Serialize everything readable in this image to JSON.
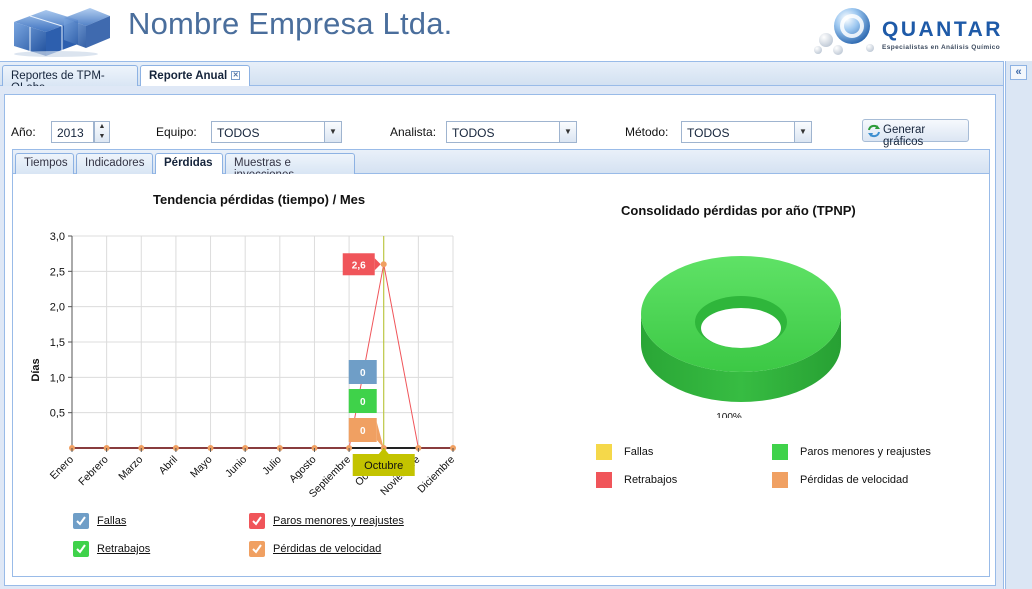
{
  "header": {
    "company_name": "Nombre Empresa Ltda.",
    "brand_name": "QUANTAR",
    "brand_tagline": "Especialistas en Análisis Químico"
  },
  "main_tabs": [
    {
      "label": "Reportes de TPM-QLabs",
      "active": false
    },
    {
      "label": "Reporte Anual",
      "active": true,
      "closable": true
    }
  ],
  "collapse_icon": "double-chevron-left-icon",
  "filters": {
    "year_label": "Año:",
    "year_value": "2013",
    "equipo_label": "Equipo:",
    "equipo_value": "TODOS",
    "analista_label": "Analista:",
    "analista_value": "TODOS",
    "metodo_label": "Método:",
    "metodo_value": "TODOS",
    "generate_label": "Generar gráficos",
    "generate_icon": "refresh-icon"
  },
  "sub_tabs": [
    {
      "label": "Tiempos",
      "active": false
    },
    {
      "label": "Indicadores",
      "active": false
    },
    {
      "label": "Pérdidas",
      "active": true
    },
    {
      "label": "Muestras e inyecciones",
      "active": false
    }
  ],
  "chart_data": [
    {
      "type": "line",
      "title": "Tendencia pérdidas (tiempo) / Mes",
      "xlabel": "",
      "ylabel": "Días",
      "ylim": [
        0,
        3.0
      ],
      "y_ticks": [
        "3,0",
        "2,5",
        "2,0",
        "1,5",
        "1,0",
        "0,5"
      ],
      "categories": [
        "Enero",
        "Febrero",
        "Marzo",
        "Abril",
        "Mayo",
        "Junio",
        "Julio",
        "Agosto",
        "Septiembre",
        "Octubre",
        "Noviembre",
        "Diciembre"
      ],
      "grid": true,
      "legend_position": "bottom",
      "series": [
        {
          "name": "Fallas",
          "color": "#6f9ec7",
          "values": [
            0,
            0,
            0,
            0,
            0,
            0,
            0,
            0,
            0,
            0,
            0,
            0
          ]
        },
        {
          "name": "Paros menores y reajustes",
          "color": "#f0555a",
          "values": [
            0,
            0,
            0,
            0,
            0,
            0,
            0,
            0,
            0,
            2.6,
            0,
            0
          ]
        },
        {
          "name": "Retrabajos",
          "color": "#3fd24a",
          "values": [
            0,
            0,
            0,
            0,
            0,
            0,
            0,
            0,
            0,
            0,
            0,
            0
          ]
        },
        {
          "name": "Pérdidas de velocidad",
          "color": "#f0a062",
          "values": [
            0,
            0,
            0,
            0,
            0,
            0,
            0,
            0,
            0,
            0,
            0,
            0
          ]
        }
      ],
      "tooltip": {
        "category": "Octubre",
        "value_labels": [
          {
            "series": "Paros menores y reajustes",
            "text": "2,6"
          },
          {
            "series": "Fallas",
            "text": "0"
          },
          {
            "series": "Retrabajos",
            "text": "0"
          },
          {
            "series": "Pérdidas de velocidad",
            "text": "0"
          }
        ]
      }
    },
    {
      "type": "pie",
      "title": "Consolidado pérdidas por año (TPNP)",
      "donut": true,
      "slices": [
        {
          "name": "Paros menores y reajustes",
          "value": 100,
          "label": "100%",
          "color": "#3fd24a"
        }
      ],
      "legend_position": "bottom",
      "legend": [
        {
          "name": "Fallas",
          "color": "#f5d84a"
        },
        {
          "name": "Paros menores y reajustes",
          "color": "#3fd24a"
        },
        {
          "name": "Retrabajos",
          "color": "#f0555a"
        },
        {
          "name": "Pérdidas de velocidad",
          "color": "#f0a062"
        }
      ]
    }
  ]
}
